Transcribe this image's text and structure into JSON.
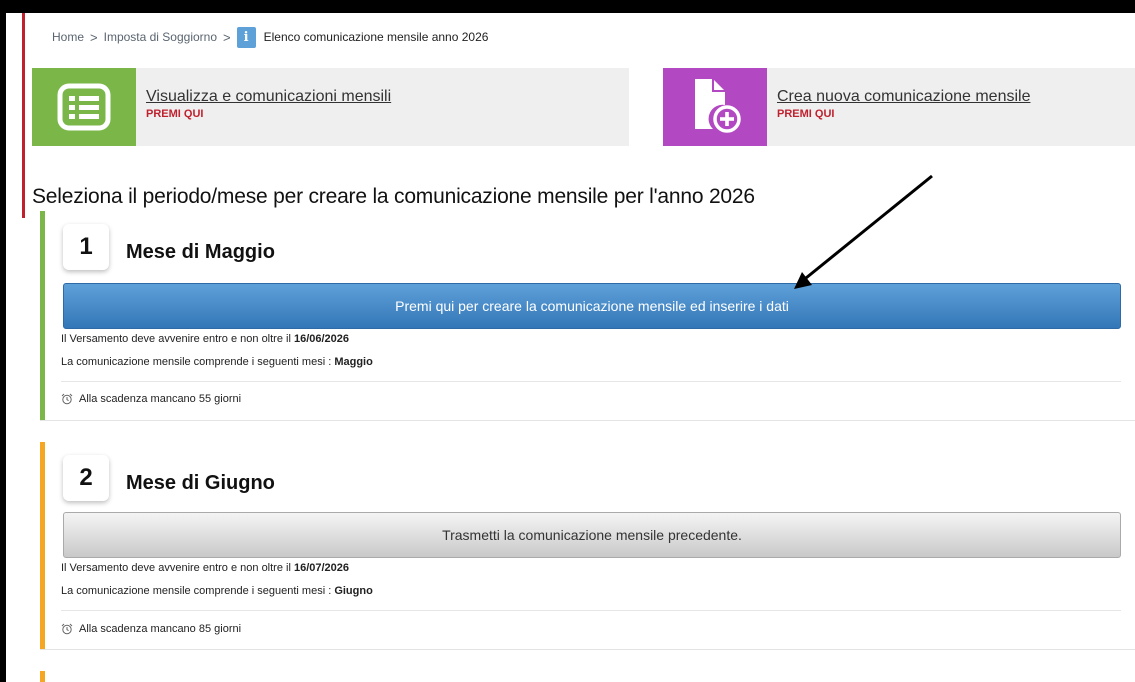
{
  "breadcrumb": {
    "home": "Home",
    "sep": ">",
    "section": "Imposta di Soggiorno",
    "info_icon": "i",
    "current": "Elenco comunicazione mensile anno 2026"
  },
  "actions": [
    {
      "label": "Visualizza e comunicazioni mensili",
      "cta": "PREMI QUI",
      "icon": "list-icon",
      "color": "#7ab648"
    },
    {
      "label": "Crea nuova comunicazione mensile",
      "cta": "PREMI QUI",
      "icon": "new-document-icon",
      "color": "#b349c2"
    }
  ],
  "section_title": "Seleziona il periodo/mese per creare la comunicazione mensile per l'anno 2026",
  "months": [
    {
      "number": "1",
      "title": "Mese di Maggio",
      "button": "Premi qui per creare la comunicazione mensile ed inserire i dati",
      "payment_prefix": "Il Versamento deve avvenire entro e non oltre il ",
      "payment_date": "16/06/2026",
      "months_prefix": "La comunicazione mensile comprende i seguenti mesi : ",
      "months_value": "Maggio",
      "deadline": "Alla scadenza mancano 55 giorni",
      "accent": "#7ab648"
    },
    {
      "number": "2",
      "title": "Mese di Giugno",
      "button": "Trasmetti la comunicazione mensile precedente.",
      "payment_prefix": "Il Versamento deve avvenire entro e non oltre il ",
      "payment_date": "16/07/2026",
      "months_prefix": "La comunicazione mensile comprende i seguenti mesi : ",
      "months_value": "Giugno",
      "deadline": "Alla scadenza mancano 85 giorni",
      "accent": "#f5a623"
    }
  ]
}
